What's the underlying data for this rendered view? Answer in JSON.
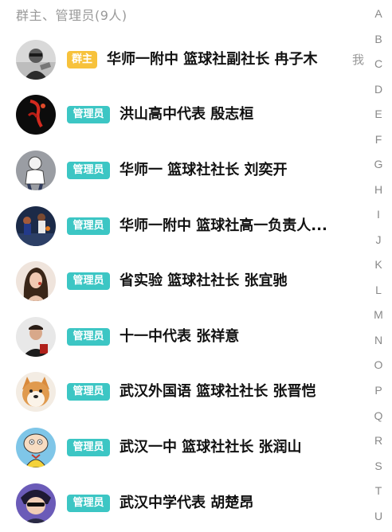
{
  "section": {
    "header": "群主、管理员(9人)"
  },
  "members": [
    {
      "badge": "群主",
      "badge_type": "owner",
      "name": "华师一附中 篮球社副社长 冉子木",
      "me": "我",
      "avatar": "photo-avatar-icon"
    },
    {
      "badge": "管理员",
      "badge_type": "admin",
      "name": "洪山高中代表 殷志桓",
      "avatar": "basketball-player-avatar-icon"
    },
    {
      "badge": "管理员",
      "badge_type": "admin",
      "name": "华师一 篮球社社长 刘奕开",
      "avatar": "cartoon-boy-avatar-icon"
    },
    {
      "badge": "管理员",
      "badge_type": "admin",
      "name": "华师一附中 篮球社高一负责人...",
      "avatar": "basketball-game-avatar-icon"
    },
    {
      "badge": "管理员",
      "badge_type": "admin",
      "name": "省实验 篮球社社长 张宜驰",
      "avatar": "woman-portrait-avatar-icon"
    },
    {
      "badge": "管理员",
      "badge_type": "admin",
      "name": "十一中代表 张祥意",
      "avatar": "man-portrait-avatar-icon"
    },
    {
      "badge": "管理员",
      "badge_type": "admin",
      "name": "武汉外国语 篮球社社长 张晋恺",
      "avatar": "shiba-dog-avatar-icon"
    },
    {
      "badge": "管理员",
      "badge_type": "admin",
      "name": "武汉一中 篮球社社长 张润山",
      "avatar": "stewie-cartoon-avatar-icon"
    },
    {
      "badge": "管理员",
      "badge_type": "admin",
      "name": "武汉中学代表 胡楚昂",
      "avatar": "anime-boy-avatar-icon"
    }
  ],
  "alpha_index": [
    "A",
    "B",
    "C",
    "D",
    "E",
    "F",
    "G",
    "H",
    "I",
    "J",
    "K",
    "L",
    "M",
    "N",
    "O",
    "P",
    "Q",
    "R",
    "S",
    "T",
    "U"
  ],
  "colors": {
    "owner_badge": "#f7c23c",
    "admin_badge": "#3cc6c4",
    "header_text": "#999999",
    "index_text": "#888888"
  }
}
